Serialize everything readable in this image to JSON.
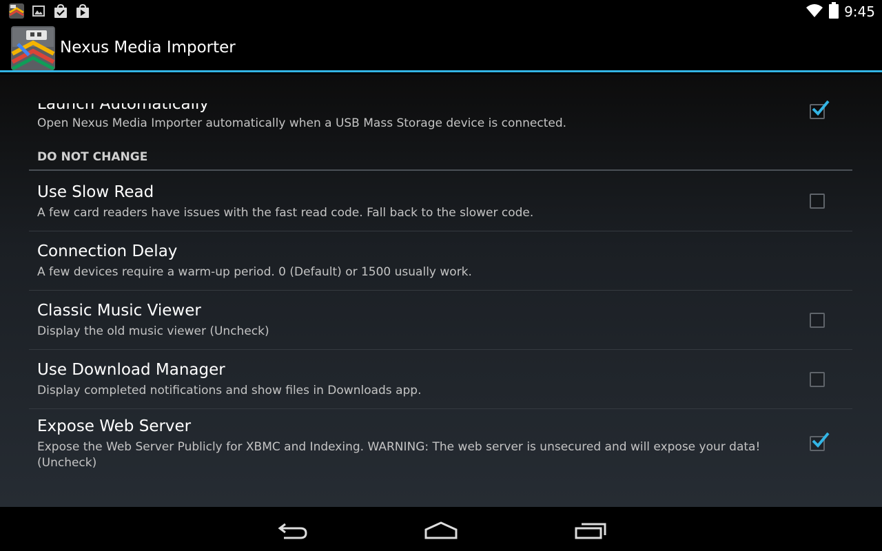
{
  "status_bar": {
    "time": "9:45",
    "left_icons": [
      "app-notification-icon",
      "image-icon",
      "shopping-bag-icon",
      "play-store-icon"
    ],
    "right_icons": [
      "wifi-icon",
      "battery-icon"
    ]
  },
  "action_bar": {
    "title": "Nexus Media Importer",
    "icon": "nexus-media-importer-app-icon",
    "accent_color": "#33b5e5"
  },
  "preferences": {
    "launch_auto": {
      "title": "Launch Automatically",
      "summary": "Open Nexus Media Importer automatically when a USB Mass Storage device is connected.",
      "checked": true
    },
    "category": {
      "label": "DO NOT CHANGE"
    },
    "items": [
      {
        "title": "Use Slow Read",
        "summary": "A few card readers have issues with the fast read code. Fall back to the slower code.",
        "checked": false
      },
      {
        "title": "Connection Delay",
        "summary": "A few devices require a warm-up period. 0 (Default) or 1500 usually work."
      },
      {
        "title": "Classic Music Viewer",
        "summary": "Display the old music viewer (Uncheck)",
        "checked": false
      },
      {
        "title": "Use Download Manager",
        "summary": "Display completed notifications and show files in Downloads app.",
        "checked": false
      },
      {
        "title": "Expose Web Server",
        "summary": "Expose the Web Server Publicly for XBMC and Indexing. WARNING: The web server is unsecured and will expose your data! (Uncheck)",
        "checked": true
      }
    ]
  },
  "nav_bar": {
    "buttons": [
      "back-icon",
      "home-icon",
      "recent-apps-icon"
    ]
  }
}
